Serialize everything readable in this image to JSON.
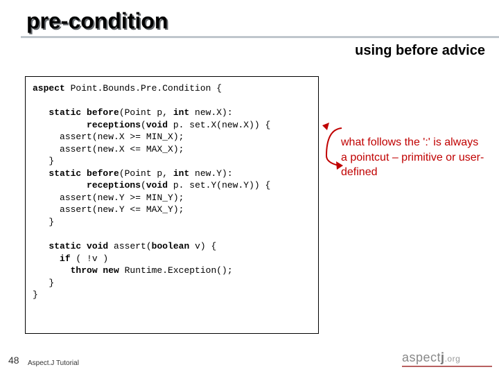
{
  "title": "pre-condition",
  "subtitle": "using before advice",
  "code": {
    "l1a": "aspect",
    "l1b": " Point.Bounds.Pre.Condition {",
    "l2a": "static before",
    "l2b": "(Point p, ",
    "l2c": "int",
    "l2d": " new.X):",
    "l3a": "receptions",
    "l3b": "(",
    "l3c": "void",
    "l3d": " p. set.X(new.X)) {",
    "l4": "assert(new.X >= MIN_X);",
    "l5": "assert(new.X <= MAX_X);",
    "l6": "}",
    "l7a": "static before",
    "l7b": "(Point p, ",
    "l7c": "int",
    "l7d": " new.Y):",
    "l8a": "receptions",
    "l8b": "(",
    "l8c": "void",
    "l8d": " p. set.Y(new.Y)) {",
    "l9": "assert(new.Y >= MIN_Y);",
    "l10": "assert(new.Y <= MAX_Y);",
    "l11": "}",
    "l12a": "static void",
    "l12b": " assert(",
    "l12c": "boolean",
    "l12d": " v) {",
    "l13a": "if",
    "l13b": " ( !v )",
    "l14a": "throw new",
    "l14b": " Runtime.Exception();",
    "l15": "}",
    "l16": "}"
  },
  "annotation": "what follows the ':' is always a pointcut – primitive or user-defined",
  "slide_number": "48",
  "footer": "Aspect.J Tutorial",
  "logo": {
    "brand_a": "aspect",
    "brand_b": "j",
    "org": ".org"
  }
}
